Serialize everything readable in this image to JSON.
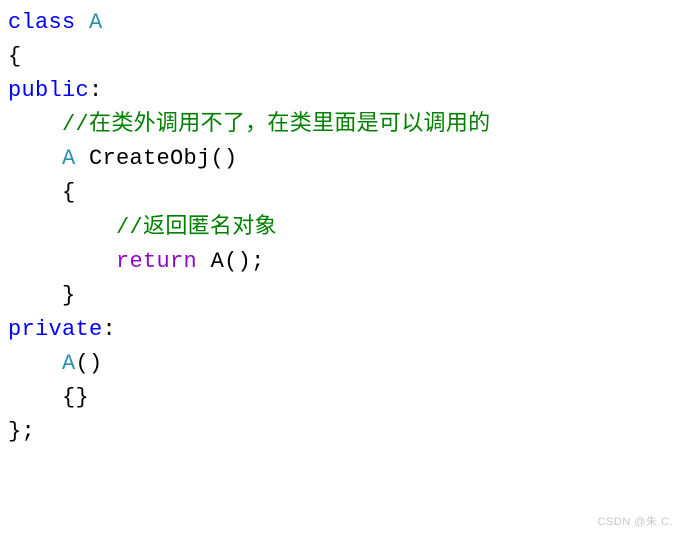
{
  "code": {
    "l1_class": "class",
    "l1_type": " A",
    "l2": "{",
    "l3_kw": "public",
    "l3_colon": ":",
    "l4_comment": "    //在类外调用不了，在类里面是可以调用的",
    "l5_type": "    A",
    "l5_fn": " CreateObj",
    "l5_paren": "()",
    "l6": "    {",
    "l7_comment": "        //返回匿名对象",
    "l8_indent": "        ",
    "l8_ret": "return",
    "l8_sp": " ",
    "l8_call": "A();",
    "l9": "    }",
    "l10_kw": "private",
    "l10_colon": ":",
    "l11_type": "    A",
    "l11_paren": "()",
    "l12": "    {}",
    "l13": "};"
  },
  "watermark": "CSDN @朱 C."
}
